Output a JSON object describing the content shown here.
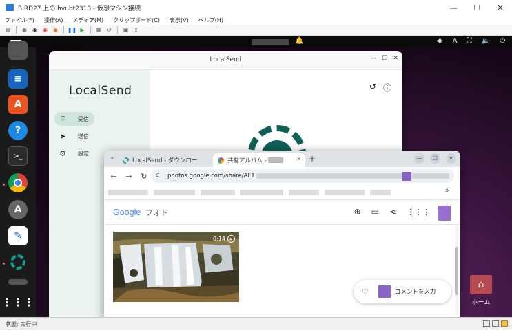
{
  "host": {
    "title": "BIRD27 上の hvubt2310 - 仮想マシン接続",
    "menu": [
      "ファイル(F)",
      "操作(A)",
      "メディア(M)",
      "クリップボード(C)",
      "表示(V)",
      "ヘルプ(H)"
    ],
    "status": "状態: 実行中",
    "window_controls": [
      "—",
      "☐",
      "✕"
    ]
  },
  "guest_topbar": {
    "keyboard": "A"
  },
  "localsend": {
    "window_title": "LocalSend",
    "brand": "LocalSend",
    "nav": [
      {
        "label": "受信",
        "icon": "wifi-icon"
      },
      {
        "label": "送信",
        "icon": "send-icon"
      },
      {
        "label": "設定",
        "icon": "gear-icon"
      }
    ]
  },
  "chrome": {
    "tabs": [
      {
        "title": "LocalSend - ダウンロー",
        "active": false
      },
      {
        "title": "共有アルバム - ",
        "active": true
      }
    ],
    "url": "photos.google.com/share/AF1",
    "google_photos": {
      "logo": "Google",
      "product": "フォト",
      "video_duration": "0:14",
      "comment_placeholder": "コメントを入力"
    }
  },
  "desktop": {
    "home_label": "ホーム"
  }
}
